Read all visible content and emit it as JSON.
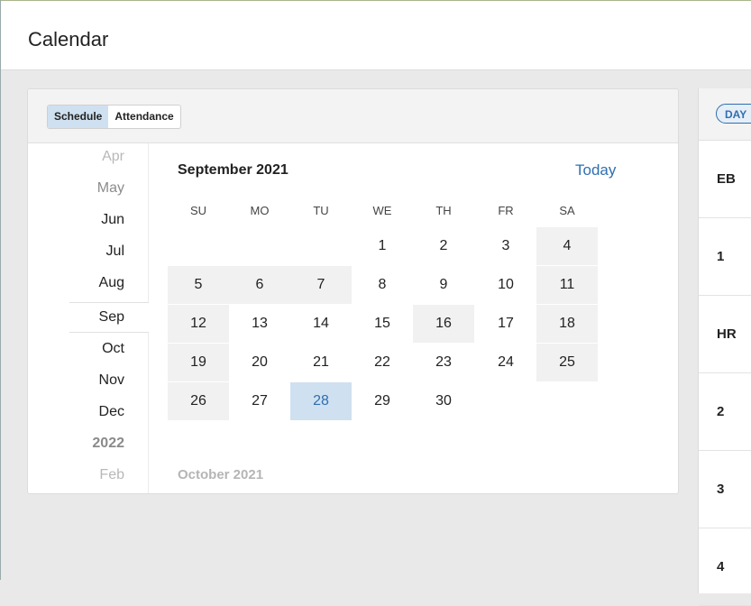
{
  "header": {
    "title": "Calendar"
  },
  "toggle": {
    "schedule": "Schedule",
    "attendance": "Attendance"
  },
  "months": [
    "Apr",
    "May",
    "Jun",
    "Jul",
    "Aug",
    "Sep",
    "Oct",
    "Nov",
    "Dec",
    "2022",
    "Feb"
  ],
  "calendar": {
    "title": "September 2021",
    "today_label": "Today",
    "weekdays": [
      "SU",
      "MO",
      "TU",
      "WE",
      "TH",
      "FR",
      "SA"
    ],
    "days": [
      "1",
      "2",
      "3",
      "4",
      "5",
      "6",
      "7",
      "8",
      "9",
      "10",
      "11",
      "12",
      "13",
      "14",
      "15",
      "16",
      "17",
      "18",
      "19",
      "20",
      "21",
      "22",
      "23",
      "24",
      "25",
      "26",
      "27",
      "28",
      "29",
      "30"
    ],
    "selected_day": "28",
    "next_title": "October 2021"
  },
  "right_panel": {
    "view_label": "DAY",
    "periods": [
      "EB",
      "1",
      "HR",
      "2",
      "3",
      "4"
    ]
  }
}
